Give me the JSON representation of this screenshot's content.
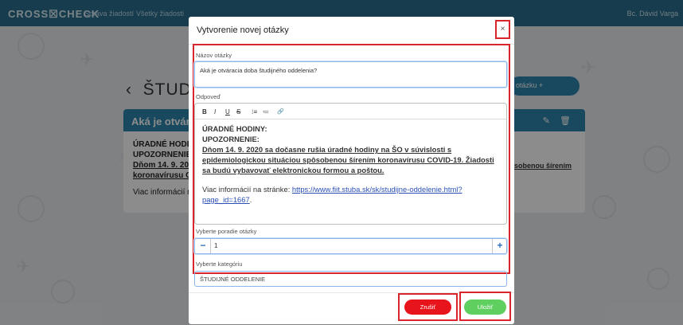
{
  "app": {
    "brand": "CROSS☒CHECK",
    "nav": [
      "Správa žiadostí",
      "Všetky žiadosti"
    ],
    "user": "Bc. Dávid Varga"
  },
  "background": {
    "page_title": "ŠTUDI",
    "add_button": "otázku +",
    "card_title": "Aká je otvára",
    "card_lines": [
      "ÚRADNÉ HODI",
      "UPOZORNENIE",
      "Dňom 14. 9. 20",
      "koronavírusu C",
      "",
      "Viac informácií n"
    ],
    "right_fragment": "sobenou šírením"
  },
  "modal": {
    "title": "Vytvorenie novej otázky",
    "close_glyph": "×",
    "name_label": "Názov otázky",
    "name_value": "Aká je otváracia doba študijného oddelenia?",
    "answer_label": "Odpoveď",
    "toolbar": [
      "B",
      "I",
      "U",
      "S",
      "⁝≡",
      "≔",
      "🔗"
    ],
    "answer": {
      "line1": "ÚRADNÉ HODINY:",
      "line2": "UPOZORNENIE:",
      "line3": "Dňom 14. 9. 2020 sa dočasne rušia úradné hodiny na ŠO v súvislosti s epidemiologickou situáciou spôsobenou šírením koronavírusu COVID-19. Žiadosti sa budú vybavovať elektronickou formou a poštou.",
      "more_prefix": "Viac informácií na stránke: ",
      "link": "https://www.fiit.stuba.sk/sk/studijne-oddelenie.html?page_id=1667",
      "more_suffix": "."
    },
    "order_label": "Vyberte poradie otázky",
    "order_minus": "−",
    "order_value": "1",
    "order_plus": "+",
    "category_label": "Vyberte kategóriu",
    "category_value": "ŠTUDIJNÉ ODDELENIE",
    "cancel_label": "Zrušiť",
    "save_label": "Uložiť"
  },
  "colors": {
    "accent": "#2e86ab",
    "cancel": "#e8141c",
    "save": "#5fd05f",
    "highlight": "#d9262c"
  }
}
